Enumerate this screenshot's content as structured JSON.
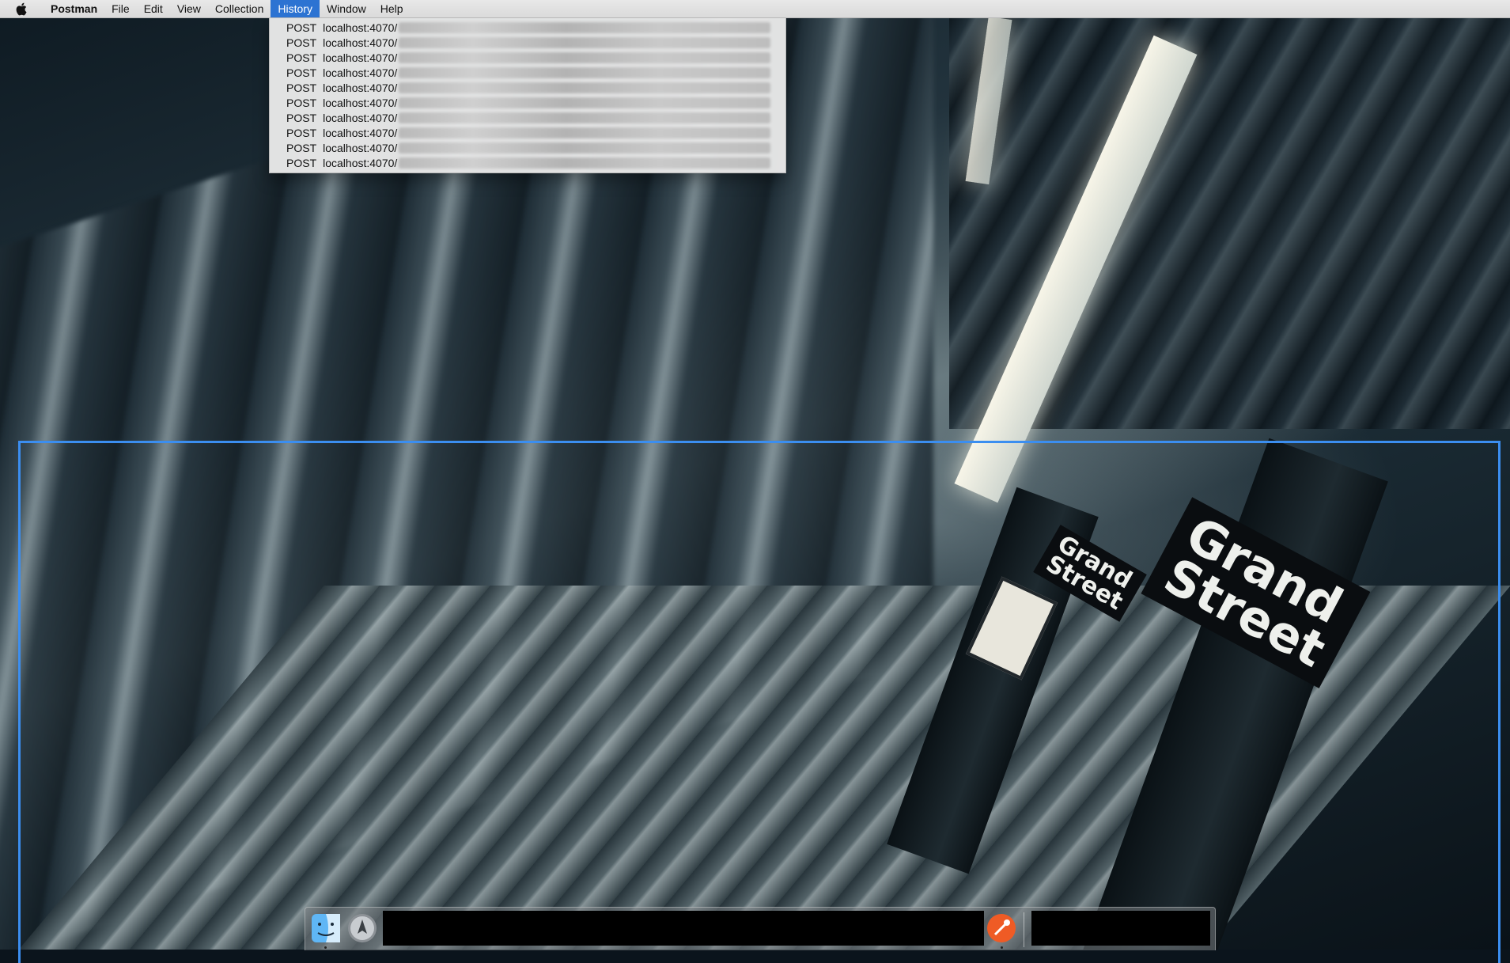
{
  "menubar": {
    "app_name": "Postman",
    "items": [
      "File",
      "Edit",
      "View",
      "Collection",
      "History",
      "Window",
      "Help"
    ],
    "active_item": "History",
    "active_color": "#2c73d2"
  },
  "history_menu": {
    "items": [
      {
        "method": "POST",
        "host": "localhost:4070/"
      },
      {
        "method": "POST",
        "host": "localhost:4070/"
      },
      {
        "method": "POST",
        "host": "localhost:4070/"
      },
      {
        "method": "POST",
        "host": "localhost:4070/"
      },
      {
        "method": "POST",
        "host": "localhost:4070/"
      },
      {
        "method": "POST",
        "host": "localhost:4070/"
      },
      {
        "method": "POST",
        "host": "localhost:4070/"
      },
      {
        "method": "POST",
        "host": "localhost:4070/"
      },
      {
        "method": "POST",
        "host": "localhost:4070/"
      },
      {
        "method": "POST",
        "host": "localhost:4070/"
      }
    ]
  },
  "wallpaper": {
    "sign_big": "Grand\nStreet",
    "sign_small": "Grand\nStreet"
  },
  "selection": {
    "color": "#3b8ef0"
  },
  "dock": {
    "icons": [
      "finder-icon",
      "launchpad-icon",
      "postman-icon"
    ]
  }
}
